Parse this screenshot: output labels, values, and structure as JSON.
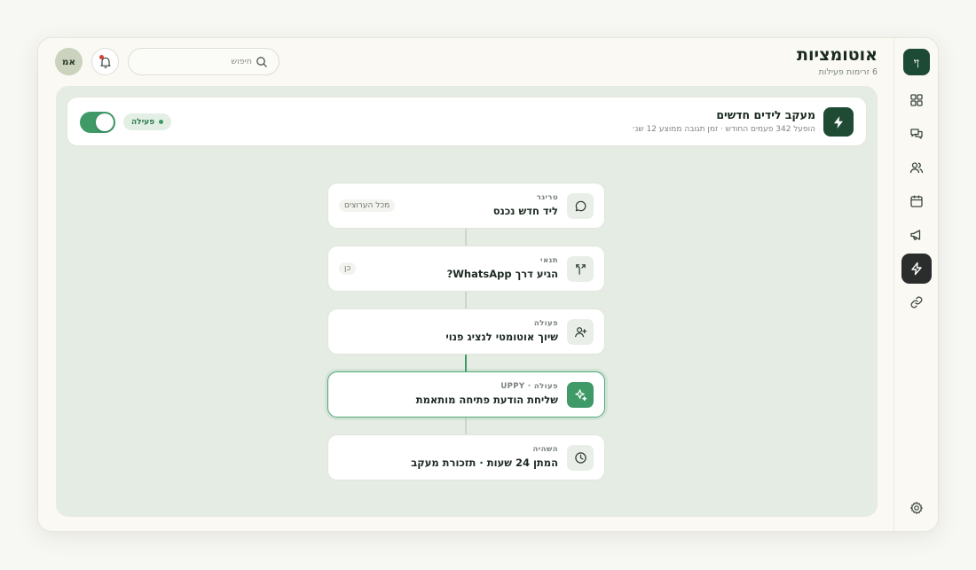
{
  "app": {
    "logo_text": "ןי"
  },
  "header": {
    "title": "אוטומציות",
    "subtitle": "6 זרימות פעילות"
  },
  "search": {
    "placeholder": "חיפוש"
  },
  "user": {
    "initials": "אמ"
  },
  "nav": [
    {
      "name": "grid-icon",
      "active": false
    },
    {
      "name": "chat-icon",
      "active": false
    },
    {
      "name": "users-icon",
      "active": false
    },
    {
      "name": "calendar-icon",
      "active": false
    },
    {
      "name": "megaphone-icon",
      "active": false
    },
    {
      "name": "bolt-icon",
      "active": true
    },
    {
      "name": "link-icon",
      "active": false
    },
    {
      "name": "settings-icon",
      "active": false
    }
  ],
  "flow": {
    "title": "מעקב לידים חדשים",
    "subtitle": "הופעל 342 פעמים החודש · זמן תגובה ממוצע 12 שנ׳",
    "status_label": "פעילה",
    "enabled": true
  },
  "steps": [
    {
      "label": "טריגר",
      "title": "ליד חדש נכנס",
      "chip": "מכל הערוצים",
      "icon": "chat-bubble-icon"
    },
    {
      "label": "תנאי",
      "title": "הגיע דרך WhatsApp?",
      "chip": "כן",
      "icon": "branch-icon"
    },
    {
      "label": "פעולה",
      "title": "שיוך אוטומטי לנציג פנוי",
      "chip": "",
      "icon": "user-plus-icon"
    },
    {
      "label": "פעולה · UPPY",
      "title": "שליחת הודעת פתיחה מותאמת",
      "chip": "",
      "icon": "sparkle-icon",
      "highlighted": true
    },
    {
      "label": "השהיה",
      "title": "המתן 24 שעות · תזכורת מעקב",
      "chip": "",
      "icon": "clock-icon"
    }
  ],
  "colors": {
    "accent": "#3f9a68",
    "brand": "#1f4b35",
    "canvas": "#e5ece4"
  }
}
